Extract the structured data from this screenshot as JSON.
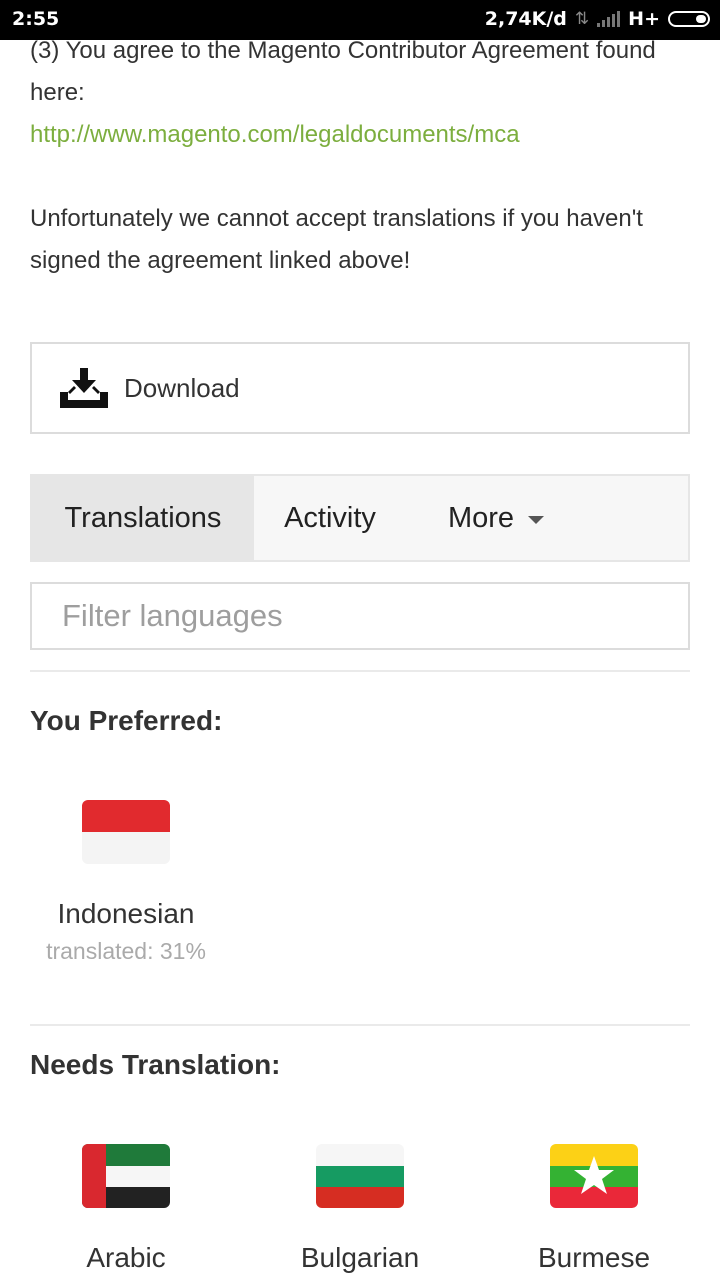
{
  "status_bar": {
    "time": "2:55",
    "network_speed": "2,74K/d",
    "network_type": "H+"
  },
  "intro": {
    "line1": "(3) You agree to the Magento Contributor Agreement found here:",
    "link": "http://www.magento.com/legaldocuments/mca",
    "warning": "Unfortunately we cannot accept translations if you haven't signed the agreement linked above!"
  },
  "download": {
    "label": "Download"
  },
  "tabs": [
    {
      "label": "Translations",
      "active": true
    },
    {
      "label": "Activity",
      "active": false
    },
    {
      "label": "More",
      "active": false
    }
  ],
  "filter": {
    "placeholder": "Filter languages",
    "value": ""
  },
  "preferred": {
    "title": "You Preferred:",
    "languages": [
      {
        "name": "Indonesian",
        "progress": "translated: 31%"
      }
    ]
  },
  "needs_translation": {
    "title": "Needs Translation:",
    "languages": [
      {
        "name": "Arabic"
      },
      {
        "name": "Bulgarian"
      },
      {
        "name": "Burmese"
      }
    ]
  },
  "colors": {
    "link": "#7cae3e",
    "tab_active_bg": "#e6e6e6"
  }
}
